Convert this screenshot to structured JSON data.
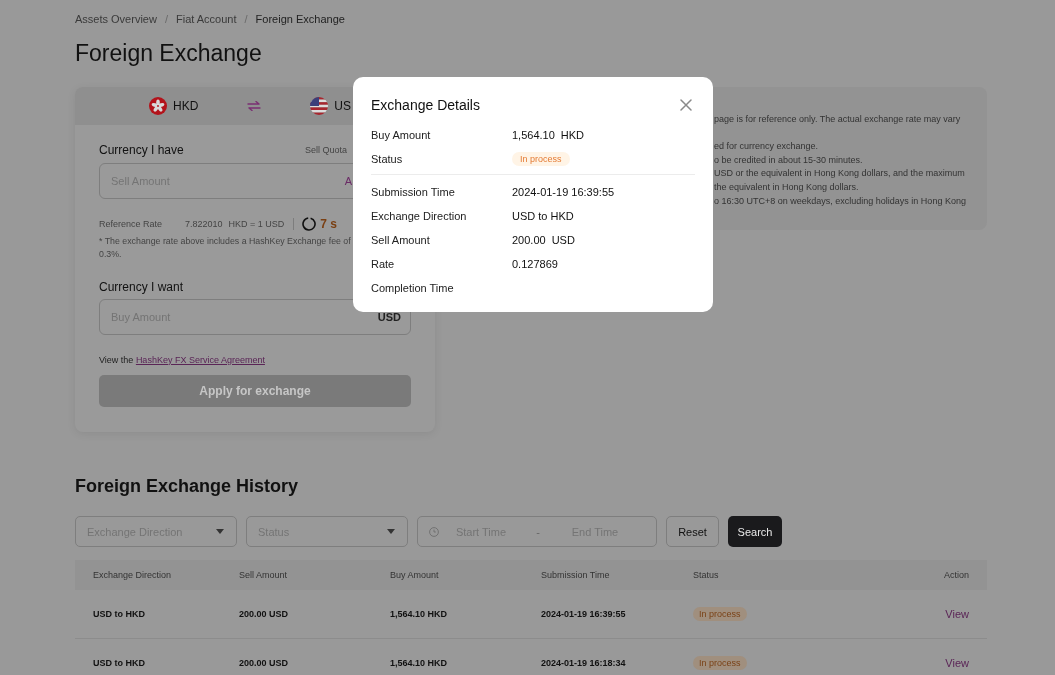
{
  "breadcrumbs": {
    "items": [
      "Assets Overview",
      "Fiat Account",
      "Foreign Exchange"
    ],
    "separator": "/"
  },
  "title": "Foreign Exchange",
  "pair": {
    "currencies": [
      {
        "kind": "hk",
        "code": "HKD"
      },
      {
        "kind": "us",
        "code": "US"
      }
    ]
  },
  "form": {
    "have_label": "Currency I have",
    "quota_label": "Sell Quota",
    "sell_field": {
      "placeholder": "Sell Amount",
      "suffix": "A"
    },
    "rate": {
      "label": "Reference Rate",
      "amount": "7.822010",
      "unit": "HKD = 1 USD",
      "countdown": "7 s"
    },
    "fee_note": "* The exchange rate above includes a HashKey Exchange fee of 0.3%.",
    "want_label": "Currency I want",
    "buy_field": {
      "placeholder": "Buy Amount",
      "suffix": "USD"
    },
    "agreement": {
      "text": "View the",
      "link": "HashKey FX Service Agreement"
    },
    "apply_button": {
      "label": "Apply for exchange",
      "disabled": true
    }
  },
  "notice": {
    "lines": [
      "page is for reference only. The actual exchange rate may vary",
      "ed for currency exchange.",
      "o be credited in about 15-30 minutes.",
      "USD or the equivalent in Hong Kong dollars, and the maximum",
      "the equivalent in Hong Kong dollars.",
      "o 16:30 UTC+8 on weekdays, excluding holidays in Hong Kong"
    ]
  },
  "history": {
    "title": "Foreign Exchange History",
    "filters": [
      {
        "kind": "select",
        "placeholder": "Exchange Direction"
      },
      {
        "kind": "select",
        "placeholder": "Status"
      },
      {
        "kind": "range",
        "start": {
          "placeholder": "Start Time"
        },
        "separator": "-",
        "end": {
          "placeholder": "End Time"
        }
      }
    ],
    "buttons": [
      {
        "kind": "outline",
        "label": "Reset"
      },
      {
        "kind": "primary",
        "label": "Search"
      }
    ],
    "table": {
      "columns": [
        "Exchange Direction",
        "Sell Amount",
        "Buy Amount",
        "Submission Time",
        "Status",
        "Action"
      ],
      "rows": [
        {
          "cells": [
            "USD to HKD",
            "200.00 USD",
            "1,564.10 HKD",
            "2024-01-19 16:39:55"
          ],
          "status": "In process",
          "action": "View"
        },
        {
          "cells": [
            "USD to HKD",
            "200.00 USD",
            "1,564.10 HKD",
            "2024-01-19 16:18:34"
          ],
          "status": "In process",
          "action": "View"
        }
      ]
    }
  },
  "modal": {
    "title": "Exchange Details",
    "groups": [
      [
        {
          "label": "Buy Amount",
          "kind": "amount",
          "amount": "1,564.10",
          "currency": "HKD"
        },
        {
          "label": "Status",
          "kind": "badge",
          "value": "In process"
        }
      ],
      [
        {
          "label": "Submission Time",
          "kind": "text",
          "value": "2024-01-19 16:39:55"
        },
        {
          "label": "Exchange Direction",
          "kind": "text",
          "value": "USD to HKD"
        },
        {
          "label": "Sell Amount",
          "kind": "amount",
          "amount": "200.00",
          "currency": "USD"
        },
        {
          "label": "Rate",
          "kind": "text",
          "value": "0.127869"
        },
        {
          "label": "Completion Time",
          "kind": "text"
        }
      ]
    ]
  }
}
